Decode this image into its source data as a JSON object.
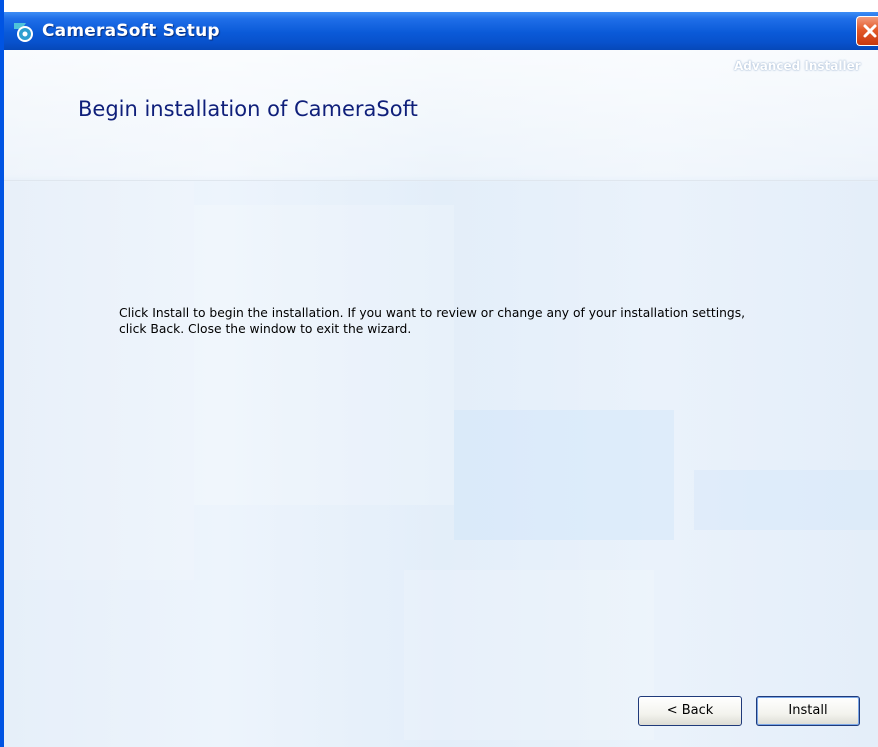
{
  "window": {
    "title": "CameraSoft Setup",
    "app_icon": "camerasoft-app-icon",
    "close_icon": "close-icon"
  },
  "header": {
    "brand": "Advanced Installer",
    "heading": "Begin installation of CameraSoft"
  },
  "body": {
    "line1": "Click Install to begin the installation.  If you want to review or change any of your installation settings,",
    "line2": "click Back.  Close the window to exit the wizard."
  },
  "buttons": {
    "back_label": "< Back",
    "install_label": "Install"
  },
  "colors": {
    "titlebar": "#0a5ad8",
    "heading": "#0f1f7a",
    "close": "#e35a2a"
  }
}
